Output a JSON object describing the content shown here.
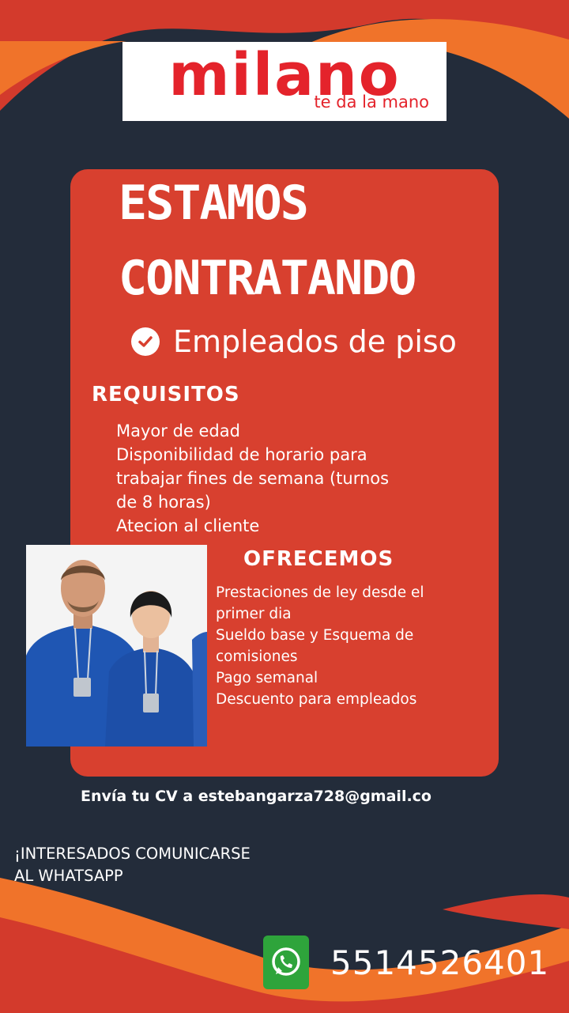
{
  "brand": {
    "name": "milano",
    "tagline": "te da la mano"
  },
  "headline": {
    "line1": "ESTAMOS",
    "line2": "CONTRATANDO"
  },
  "position": "Empleados de piso",
  "requirements": {
    "title": "REQUISITOS",
    "items": [
      "Mayor de edad",
      "Disponibilidad de horario para",
      "trabajar fines de semana (turnos",
      "de 8 horas)",
      "Atecion al cliente"
    ]
  },
  "offer": {
    "title": "OFRECEMOS",
    "items": [
      "Prestaciones de ley desde el",
      "primer dia",
      "Sueldo base y Esquema de",
      "comisiones",
      "Pago semanal",
      "Descuento para empleados"
    ]
  },
  "cv": "Envía tu CV a estebangarza728@gmail.co",
  "contact": {
    "line1": "¡INTERESADOS COMUNICARSE",
    "line2": "AL WHATSAPP"
  },
  "phone": "5514526401",
  "icons": {
    "check": "check-circle-icon",
    "whatsapp": "whatsapp-icon"
  },
  "colors": {
    "background": "#232c3a",
    "accent_red": "#d8402f",
    "accent_orange": "#f0732a",
    "brand_red": "#e4232b",
    "whatsapp_green": "#2ea43b"
  }
}
